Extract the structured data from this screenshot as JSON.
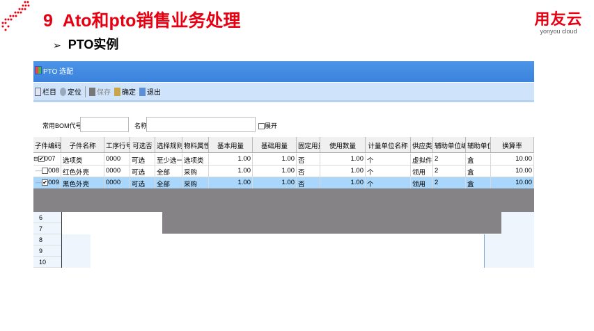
{
  "slide": {
    "number": "9",
    "title": "Ato和pto销售业务处理",
    "subtitle": "PTO实例",
    "bullet": "➢",
    "logo_cn": "用友云",
    "logo_en": "yonyou cloud"
  },
  "window": {
    "title": "PTO 选配",
    "toolbar": [
      {
        "label": "栏目",
        "icon": "columns-icon"
      },
      {
        "label": "定位",
        "icon": "locate-icon"
      },
      {
        "label": "保存",
        "icon": "save-icon",
        "disabled": true
      },
      {
        "label": "确定",
        "icon": "confirm-icon"
      },
      {
        "label": "退出",
        "icon": "exit-icon"
      }
    ],
    "form": {
      "bom_label": "常用BOM代号",
      "bom_value": "",
      "name_label": "名称",
      "name_value": "",
      "expand_label": "展开"
    },
    "columns": [
      "子件编码",
      "子件名称",
      "工序行号",
      "可选否",
      "选择规则",
      "物料属性",
      "基本用量",
      "基础用量",
      "固定用量",
      "使用数量",
      "计量单位名称",
      "供应类型",
      "辅助单位编码",
      "辅助单位",
      "换算率"
    ],
    "rows": [
      {
        "code": "007",
        "name": "选项类",
        "op": "0000",
        "optional": "可选",
        "rule": "至少选一个",
        "attr": "选项类",
        "base": "1.00",
        "basis": "1.00",
        "fixed": "否",
        "qty": "1.00",
        "unit": "个",
        "supply": "虚拟件",
        "aux_code": "2",
        "aux_unit": "盒",
        "rate": "10.00",
        "checked": true
      },
      {
        "code": "008",
        "name": "红色外壳",
        "op": "0000",
        "optional": "可选",
        "rule": "全部",
        "attr": "采购",
        "base": "1.00",
        "basis": "1.00",
        "fixed": "否",
        "qty": "1.00",
        "unit": "个",
        "supply": "领用",
        "aux_code": "2",
        "aux_unit": "盒",
        "rate": "10.00",
        "checked": false
      },
      {
        "code": "009",
        "name": "黑色外壳",
        "op": "0000",
        "optional": "可选",
        "rule": "全部",
        "attr": "采购",
        "base": "1.00",
        "basis": "1.00",
        "fixed": "否",
        "qty": "1.00",
        "unit": "个",
        "supply": "领用",
        "aux_code": "2",
        "aux_unit": "盒",
        "rate": "10.00",
        "checked": true
      }
    ],
    "row_numbers": [
      "6",
      "7",
      "8",
      "9",
      "10"
    ]
  },
  "colors": {
    "accent": "#e60012",
    "titlebar": "#3a82dc",
    "selected_row": "#a9d6fb"
  }
}
